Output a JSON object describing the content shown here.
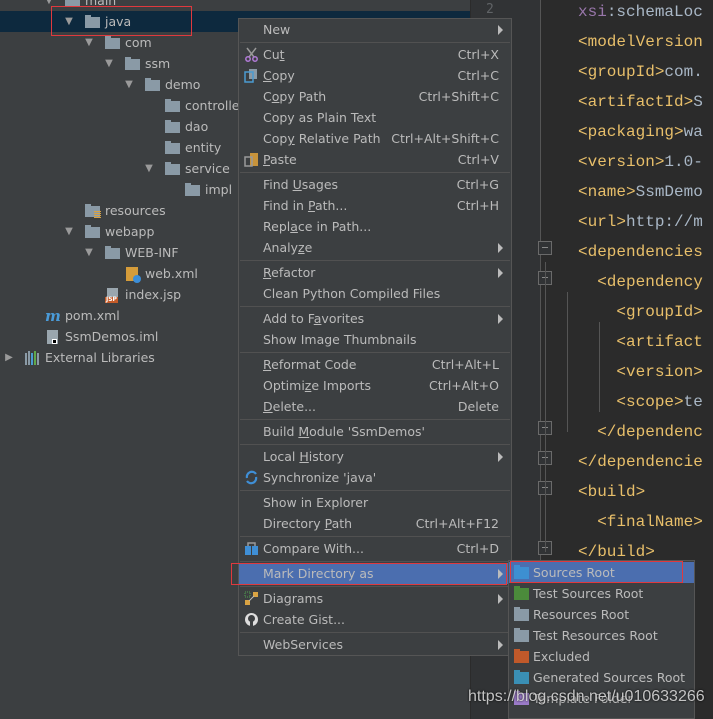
{
  "project_tree": {
    "items": [
      {
        "label": "main",
        "indent": 2,
        "expanded": true,
        "icon": "folder-icon"
      },
      {
        "label": "java",
        "indent": 3,
        "expanded": true,
        "icon": "folder-icon",
        "selected": true
      },
      {
        "label": "com",
        "indent": 4,
        "expanded": true,
        "icon": "folder-icon"
      },
      {
        "label": "ssm",
        "indent": 5,
        "expanded": true,
        "icon": "folder-icon"
      },
      {
        "label": "demo",
        "indent": 6,
        "expanded": true,
        "icon": "folder-icon"
      },
      {
        "label": "controller",
        "indent": 7,
        "icon": "folder-icon"
      },
      {
        "label": "dao",
        "indent": 7,
        "icon": "folder-icon"
      },
      {
        "label": "entity",
        "indent": 7,
        "icon": "folder-icon"
      },
      {
        "label": "service",
        "indent": 7,
        "expanded": true,
        "icon": "folder-icon"
      },
      {
        "label": "impl",
        "indent": 8,
        "icon": "folder-icon"
      },
      {
        "label": "resources",
        "indent": 3,
        "icon": "resources-folder-icon"
      },
      {
        "label": "webapp",
        "indent": 3,
        "expanded": true,
        "icon": "folder-icon"
      },
      {
        "label": "WEB-INF",
        "indent": 4,
        "expanded": true,
        "icon": "folder-icon"
      },
      {
        "label": "web.xml",
        "indent": 5,
        "icon": "web-xml-icon"
      },
      {
        "label": "index.jsp",
        "indent": 4,
        "icon": "jsp-file-icon"
      },
      {
        "label": "pom.xml",
        "indent": 1,
        "icon": "maven-icon"
      },
      {
        "label": "SsmDemos.iml",
        "indent": 1,
        "icon": "iml-file-icon"
      },
      {
        "label": "External Libraries",
        "indent": 0,
        "expanded": false,
        "icon": "libraries-icon"
      }
    ]
  },
  "editor": {
    "line_number": "2",
    "lines": [
      {
        "parts": [
          {
            "t": "xsi",
            "c": "attr"
          },
          {
            "t": ":schemaLoc",
            "c": "txt"
          }
        ]
      },
      {
        "parts": [
          {
            "t": "<modelVersion",
            "c": "tag"
          }
        ]
      },
      {
        "parts": [
          {
            "t": "<groupId>",
            "c": "tag"
          },
          {
            "t": "com.",
            "c": "txt"
          }
        ]
      },
      {
        "parts": [
          {
            "t": "<artifactId>",
            "c": "tag"
          },
          {
            "t": "S",
            "c": "txt"
          }
        ]
      },
      {
        "parts": [
          {
            "t": "<packaging>",
            "c": "tag"
          },
          {
            "t": "wa",
            "c": "txt"
          }
        ]
      },
      {
        "parts": [
          {
            "t": "<version>",
            "c": "tag"
          },
          {
            "t": "1.0-",
            "c": "txt"
          }
        ]
      },
      {
        "parts": [
          {
            "t": "<name>",
            "c": "tag"
          },
          {
            "t": "SsmDemo",
            "c": "txt"
          }
        ]
      },
      {
        "parts": [
          {
            "t": "<url>",
            "c": "tag"
          },
          {
            "t": "http://m",
            "c": "txt"
          }
        ]
      },
      {
        "parts": [
          {
            "t": "<dependencies",
            "c": "tag"
          }
        ]
      },
      {
        "parts": [
          {
            "t": "  <dependency",
            "c": "tag"
          }
        ]
      },
      {
        "parts": [
          {
            "t": "    <groupId>",
            "c": "tag"
          }
        ]
      },
      {
        "parts": [
          {
            "t": "    <artifact",
            "c": "tag"
          }
        ]
      },
      {
        "parts": [
          {
            "t": "    <version>",
            "c": "tag"
          }
        ]
      },
      {
        "parts": [
          {
            "t": "    <scope>",
            "c": "tag"
          },
          {
            "t": "te",
            "c": "txt"
          }
        ]
      },
      {
        "parts": [
          {
            "t": "  </dependenc",
            "c": "tag"
          }
        ]
      },
      {
        "parts": [
          {
            "t": "</dependencie",
            "c": "tag"
          }
        ]
      },
      {
        "parts": [
          {
            "t": "<build>",
            "c": "tag"
          }
        ]
      },
      {
        "parts": [
          {
            "t": "  <finalName>",
            "c": "tag"
          }
        ]
      },
      {
        "parts": [
          {
            "t": "</build>",
            "c": "tag"
          }
        ]
      }
    ]
  },
  "context_menu": {
    "items": [
      {
        "label": "New",
        "submenu": true
      },
      {
        "sep": true
      },
      {
        "label": "Cut",
        "shortcut": "Ctrl+X",
        "icon": "scissors-icon",
        "mn": 2
      },
      {
        "label": "Copy",
        "shortcut": "Ctrl+C",
        "icon": "copy-icon",
        "mn": 0
      },
      {
        "label": "Copy Path",
        "shortcut": "Ctrl+Shift+C",
        "mn": 1
      },
      {
        "label": "Copy as Plain Text"
      },
      {
        "label": "Copy Relative Path",
        "shortcut": "Ctrl+Alt+Shift+C",
        "mn": 3
      },
      {
        "label": "Paste",
        "shortcut": "Ctrl+V",
        "icon": "paste-icon",
        "mn": 0
      },
      {
        "sep": true
      },
      {
        "label": "Find Usages",
        "shortcut": "Ctrl+G",
        "mn": 5
      },
      {
        "label": "Find in Path...",
        "shortcut": "Ctrl+H",
        "mn": 8
      },
      {
        "label": "Replace in Path...",
        "mn": 4
      },
      {
        "label": "Analyze",
        "submenu": true,
        "mn": 5
      },
      {
        "sep": true
      },
      {
        "label": "Refactor",
        "submenu": true,
        "mn": 0
      },
      {
        "label": "Clean Python Compiled Files"
      },
      {
        "sep": true
      },
      {
        "label": "Add to Favorites",
        "submenu": true,
        "mn": 8
      },
      {
        "label": "Show Image Thumbnails"
      },
      {
        "sep": true
      },
      {
        "label": "Reformat Code",
        "shortcut": "Ctrl+Alt+L",
        "mn": 0
      },
      {
        "label": "Optimize Imports",
        "shortcut": "Ctrl+Alt+O",
        "mn": 6
      },
      {
        "label": "Delete...",
        "shortcut": "Delete",
        "mn": 0
      },
      {
        "sep": true
      },
      {
        "label": "Build Module 'SsmDemos'",
        "mn": 6
      },
      {
        "sep": true
      },
      {
        "label": "Local History",
        "submenu": true,
        "mn": 6
      },
      {
        "label": "Synchronize 'java'",
        "icon": "sync-icon"
      },
      {
        "sep": true
      },
      {
        "label": "Show in Explorer"
      },
      {
        "label": "Directory Path",
        "shortcut": "Ctrl+Alt+F12",
        "mn": 10
      },
      {
        "sep": true
      },
      {
        "label": "Compare With...",
        "shortcut": "Ctrl+D",
        "icon": "compare-icon"
      },
      {
        "sep": true
      },
      {
        "label": "Mark Directory as",
        "submenu": true,
        "highlighted": true
      },
      {
        "sep": true
      },
      {
        "label": "Diagrams",
        "submenu": true,
        "icon": "diagrams-icon"
      },
      {
        "label": "Create Gist...",
        "icon": "github-icon"
      },
      {
        "sep": true
      },
      {
        "label": "WebServices",
        "submenu": true
      }
    ]
  },
  "mark_directory_submenu": {
    "items": [
      {
        "label": "Sources Root",
        "color": "#3d8fd1",
        "highlighted": true,
        "icon": "sources-root-icon"
      },
      {
        "label": "Test Sources Root",
        "color": "#4b8b3b",
        "icon": "test-sources-root-icon"
      },
      {
        "label": "Resources Root",
        "color": "#8a9aa6",
        "icon": "resources-root-icon"
      },
      {
        "label": "Test Resources Root",
        "color": "#8a9aa6",
        "icon": "test-resources-root-icon"
      },
      {
        "label": "Excluded",
        "color": "#c0592a",
        "icon": "excluded-icon"
      },
      {
        "label": "Generated Sources Root",
        "color": "#3a8fb5",
        "icon": "generated-sources-root-icon"
      },
      {
        "label": "Template Folder",
        "color": "#9b7bc9",
        "icon": "template-folder-icon"
      }
    ]
  },
  "watermark": "https://blog.csdn.net/u010633266"
}
